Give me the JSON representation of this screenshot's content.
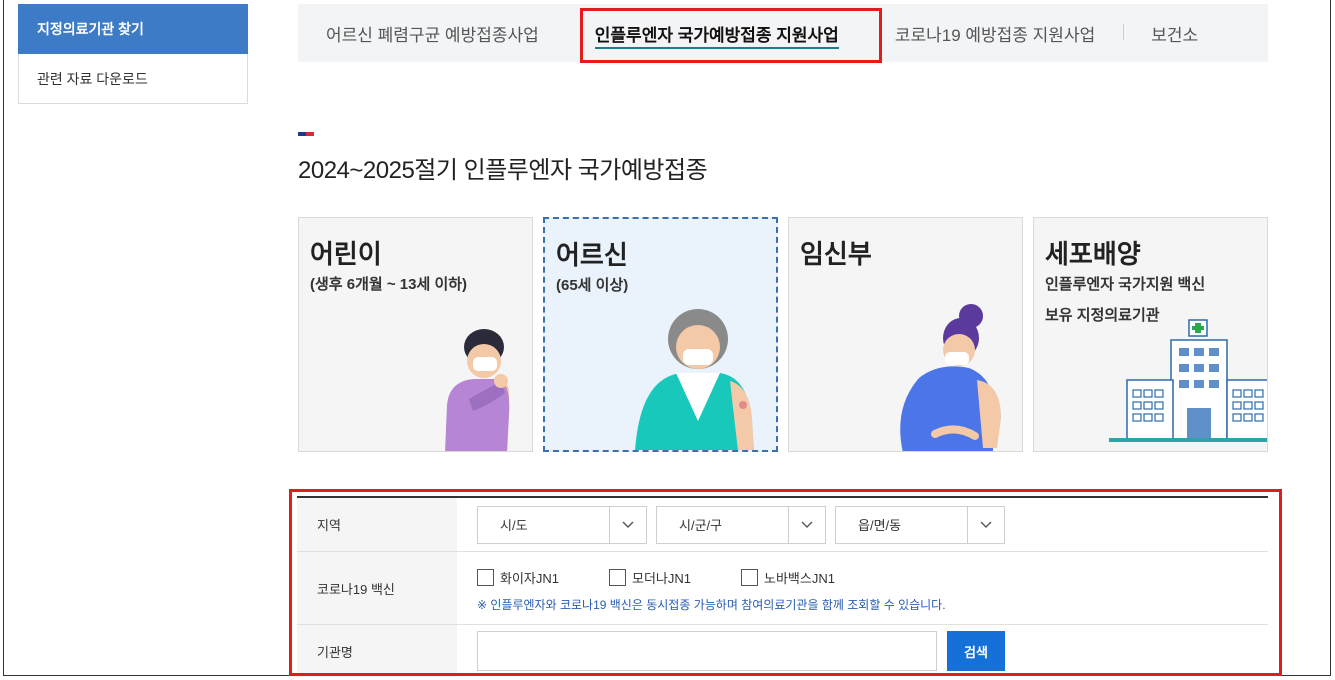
{
  "sidebar": {
    "items": [
      {
        "label": "지정의료기관 찾기"
      },
      {
        "label": "관련 자료 다운로드"
      }
    ]
  },
  "tabs": [
    {
      "label": "어르신 폐렴구균 예방접종사업"
    },
    {
      "label": "인플루엔자 국가예방접종 지원사업"
    },
    {
      "label": "코로나19 예방접종 지원사업"
    },
    {
      "label": "보건소"
    }
  ],
  "heading": {
    "title": "2024~2025절기 인플루엔자 국가예방접종"
  },
  "cards": [
    {
      "title": "어린이",
      "subtitle": "(생후 6개월 ~ 13세 이하)"
    },
    {
      "title": "어르신",
      "subtitle": "(65세 이상)"
    },
    {
      "title": "임신부"
    },
    {
      "title": "세포배양",
      "subtitle": "인플루엔자 국가지원 백신",
      "subtitle2": "보유 지정의료기관"
    }
  ],
  "form": {
    "region_label": "지역",
    "region_selects": [
      "시/도",
      "시/군/구",
      "읍/면/동"
    ],
    "covid_label": "코로나19 백신",
    "covid_options": [
      "화이자JN1",
      "모더나JN1",
      "노바백스JN1"
    ],
    "covid_note": "※ 인플루엔자와 코로나19 백신은 동시접종 가능하며 참여의료기관을 함께 조회할 수 있습니다.",
    "name_label": "기관명",
    "name_value": "",
    "search_label": "검색"
  },
  "colors": {
    "sidebar_active": "#3d7bc7",
    "highlight": "#e31b1b",
    "search_button": "#1571d8",
    "note_text": "#2a5db0"
  }
}
